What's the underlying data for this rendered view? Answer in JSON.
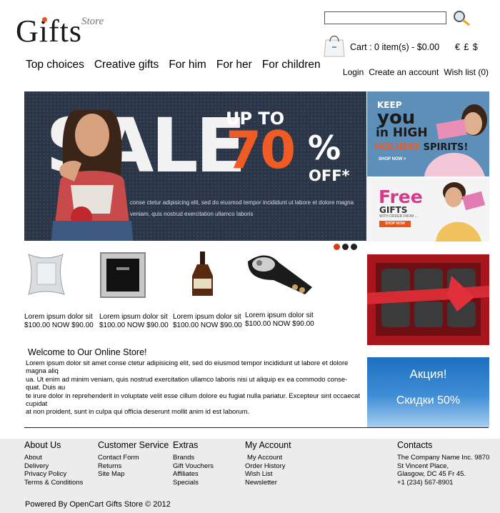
{
  "header": {
    "logo_main": "Gifts",
    "logo_sub": "Store",
    "search_placeholder": "",
    "cart_text": "Cart :  0 item(s) - $0.00",
    "currencies": "€ £ $"
  },
  "nav": [
    "Top choices",
    "Creative gifts",
    "For him",
    "For her",
    "For children"
  ],
  "account_links": [
    "Login",
    "Create an account",
    "Wish list (0)"
  ],
  "banner": {
    "sale": "SALE",
    "upto": "UP TO",
    "percent": "70",
    "pct_sign": "%",
    "off": "OFF*",
    "lorem1": "conse ctetur adipisicing elit, sed do eiusmod tempor incididunt ut labore et dolore magna",
    "lorem2": "veniam, quis nostrud exercitation ullamco laboris"
  },
  "slider": {
    "count": 3,
    "active": 0
  },
  "promo1": {
    "keep": "KEEP",
    "you": "you",
    "high": "in HIGH",
    "spirits_a": "HOLIDAY",
    "spirits_b": "SPIRITS!",
    "shop": "SHOP NOW >"
  },
  "promo2": {
    "free": "Free",
    "gifts": "GIFTS",
    "with": "WITH ORDER FROM ...",
    "shop": "SHOP NOW"
  },
  "products": [
    {
      "name": "Lorem ipsum dolor sit",
      "price": "$100.00 NOW $90.00"
    },
    {
      "name": "Lorem ipsum dolor sit",
      "price": "$100.00 NOW $90.00"
    },
    {
      "name": "Lorem ipsum dolor sit",
      "price": "$100.00 NOW $90.00"
    },
    {
      "name": "Lorem ipsum dolor sit",
      "price": "$100.00 NOW $90.00"
    }
  ],
  "welcome": {
    "title": "Welcome to Our Online Store!",
    "lines": [
      "Lorem ipsum dolor sit amet conse ctetur adipisicing elit, sed do eiusmod tempor incididunt ut labore et dolore magna aliq",
      "ua. Ut enim ad minim veniam, quis nostrud exercitation ullamco laboris nisi ut aliquip ex ea commodo conse-quat. Duis au",
      "te irure dolor in reprehenderit in voluptate velit esse cillum dolore eu fugiat nulla pariatur. Excepteur sint occaecat cupidat",
      "at non proident, sunt in culpa qui officia deserunt mollit anim id est laborum."
    ]
  },
  "blue_promo": {
    "line1": "Акция!",
    "line2": "Скидки 50%"
  },
  "footer": {
    "about": {
      "title": "About Us",
      "links": [
        "About",
        "Delivery",
        "Privacy Policy",
        "Terms & Conditions"
      ]
    },
    "service": {
      "title": "Customer Service",
      "links": [
        "Contact Form",
        "Returns",
        "Site Map"
      ]
    },
    "extras": {
      "title": "Extras",
      "links": [
        "Brands",
        "Gift Vouchers",
        "Affiliates",
        "Specials"
      ]
    },
    "account": {
      "title": "My Account",
      "links": [
        "My Account",
        "Order History",
        "Wish List",
        "Newsletter"
      ]
    },
    "contacts": {
      "title": "Contacts",
      "lines": [
        "The Company Name Inc. 9870",
        "St Vincent Place,",
        "Glasgow, DC 45 Fr 45.",
        "+1 (234) 567-8901"
      ]
    },
    "powered": "Powered By OpenCart Gifts Store © 2012"
  },
  "colors": {
    "accent": "#f05a24",
    "banner_bg": "#2b3546",
    "footer_bg": "#ececec",
    "promo_blue": "#1d6fbf"
  }
}
